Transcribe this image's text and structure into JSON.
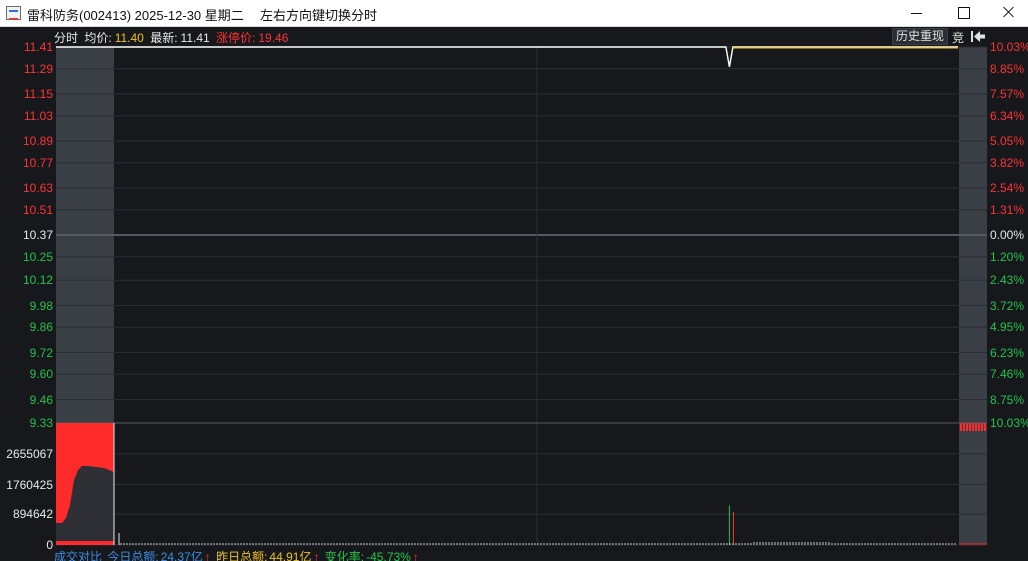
{
  "window": {
    "title": "雷科防务(002413) 2025-12-30 星期二",
    "hint": "左右方向键切换分时"
  },
  "header": {
    "mode": "分时",
    "avg_label": "均价:",
    "avg_value": "11.40",
    "latest_label": "最新:",
    "latest_value": "11.41",
    "limit_label": "涨停价:",
    "limit_value": "19.46",
    "history_button": "历史重现",
    "bid_label": "竞"
  },
  "price_axis": [
    {
      "price": "11.41",
      "pct": "10.03%",
      "color": "#ff3333",
      "value": 11.41
    },
    {
      "price": "11.29",
      "pct": "8.85%",
      "color": "#ff3333",
      "value": 11.29
    },
    {
      "price": "11.15",
      "pct": "7.57%",
      "color": "#ff3333",
      "value": 11.15
    },
    {
      "price": "11.03",
      "pct": "6.34%",
      "color": "#ff3333",
      "value": 11.03
    },
    {
      "price": "10.89",
      "pct": "5.05%",
      "color": "#ff3333",
      "value": 10.89
    },
    {
      "price": "10.77",
      "pct": "3.82%",
      "color": "#ff3333",
      "value": 10.77
    },
    {
      "price": "10.63",
      "pct": "2.54%",
      "color": "#ff3333",
      "value": 10.63
    },
    {
      "price": "10.51",
      "pct": "1.31%",
      "color": "#ff3333",
      "value": 10.51
    },
    {
      "price": "10.37",
      "pct": "0.00%",
      "color": "#e8e8e8",
      "value": 10.37
    },
    {
      "price": "10.25",
      "pct": "1.20%",
      "color": "#22c44a",
      "value": 10.25
    },
    {
      "price": "10.12",
      "pct": "2.43%",
      "color": "#22c44a",
      "value": 10.12
    },
    {
      "price": "9.98",
      "pct": "3.72%",
      "color": "#22c44a",
      "value": 9.98
    },
    {
      "price": "9.86",
      "pct": "4.95%",
      "color": "#22c44a",
      "value": 9.86
    },
    {
      "price": "9.72",
      "pct": "6.23%",
      "color": "#22c44a",
      "value": 9.72
    },
    {
      "price": "9.60",
      "pct": "7.46%",
      "color": "#22c44a",
      "value": 9.6
    },
    {
      "price": "9.46",
      "pct": "8.75%",
      "color": "#22c44a",
      "value": 9.46
    },
    {
      "price": "9.33",
      "pct": "10.03%",
      "color": "#22c44a",
      "value": 9.33
    }
  ],
  "volume_axis": [
    "2655067",
    "1760425",
    "894642",
    "0"
  ],
  "chart_data": {
    "type": "line",
    "title": "",
    "ylim": [
      9.33,
      11.41
    ],
    "base_price": 10.37,
    "series": [
      {
        "name": "",
        "x": [
          "09:30",
          "13:54",
          "13:55",
          "13:56",
          "15:00"
        ],
        "values": [
          11.41,
          11.41,
          11.3,
          11.41,
          11.41
        ]
      }
    ],
    "volume_ylim": [
      0,
      3550000
    ],
    "volume_spikes": [
      {
        "time": "09:30",
        "value": 3550000
      },
      {
        "time": "13:55",
        "value": 1150000
      }
    ]
  },
  "footer": {
    "compare_label": "成交对比",
    "today_label": "今日总额:",
    "today_value": "24.37亿",
    "yest_label": "昨日总额:",
    "yest_value": "44.91亿",
    "change_label": "变化率:",
    "change_value": "-45.73%",
    "arrow": "↑"
  },
  "colors": {
    "background": "#16181c",
    "price_line": "#ffffff",
    "avg_line": "#f0c020",
    "up": "#ff3333",
    "down": "#22c44a"
  }
}
